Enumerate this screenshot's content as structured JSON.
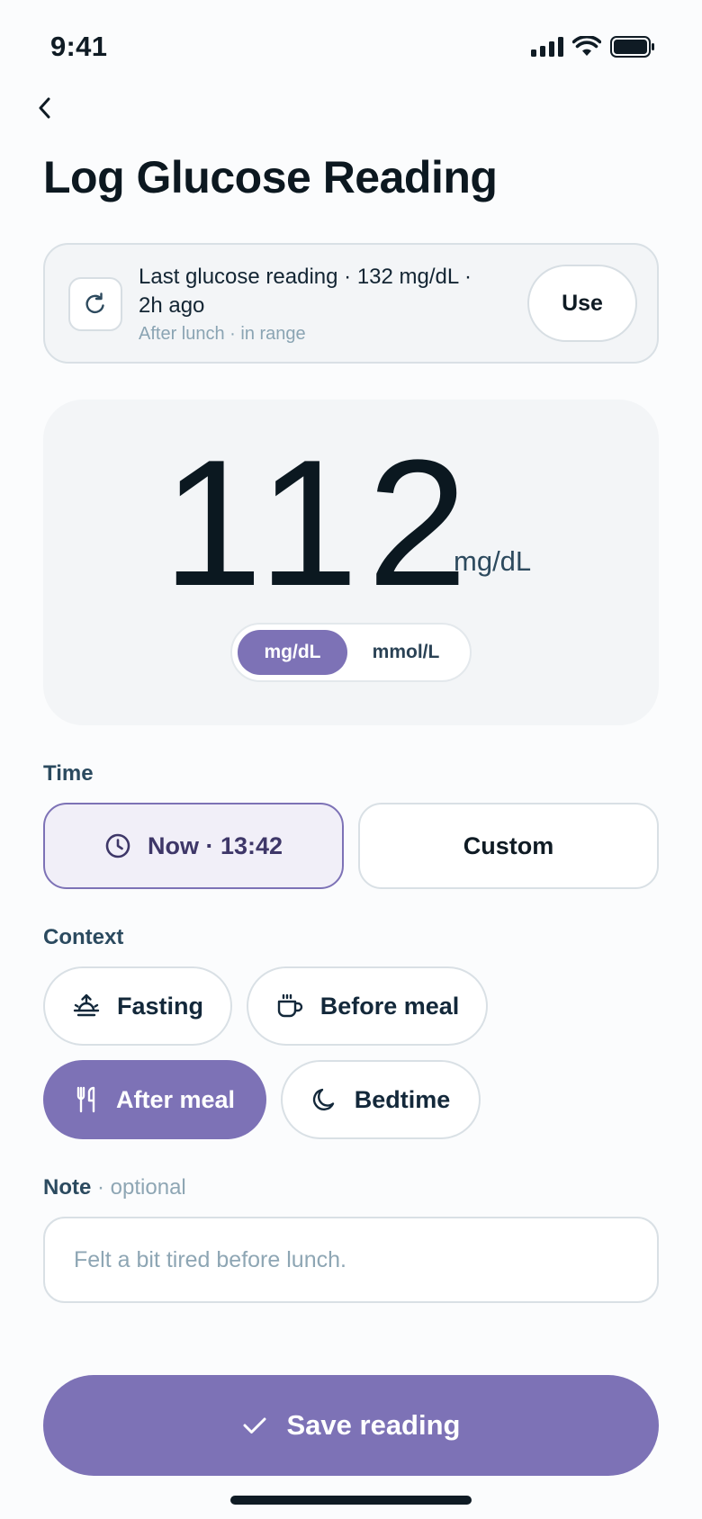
{
  "status_bar": {
    "time": "9:41"
  },
  "header": {
    "title": "Log Glucose Reading"
  },
  "last_reading": {
    "text": "Last glucose reading · 132 mg/dL · 2h ago",
    "subtext": "After lunch · in range",
    "use_label": "Use"
  },
  "reading": {
    "value": "112",
    "unit": "mg/dL",
    "unit_options": [
      "mg/dL",
      "mmol/L"
    ],
    "selected_unit": "mg/dL"
  },
  "time_section": {
    "label": "Time",
    "now_label": "Now · 13:42",
    "custom_label": "Custom",
    "selected": "now"
  },
  "context_section": {
    "label": "Context",
    "options": [
      {
        "label": "Fasting",
        "icon": "sunrise-icon"
      },
      {
        "label": "Before meal",
        "icon": "coffee-cup-icon"
      },
      {
        "label": "After meal",
        "icon": "utensils-icon"
      },
      {
        "label": "Bedtime",
        "icon": "moon-icon"
      }
    ],
    "selected": "After meal"
  },
  "note_section": {
    "label": "Note",
    "optional": "· optional",
    "value": "",
    "placeholder": "Felt a bit tired before lunch."
  },
  "save": {
    "label": "Save reading"
  },
  "colors": {
    "accent": "#7d72b6",
    "accent_tint": "#f1eff8",
    "card_bg": "#f3f5f7",
    "border": "#d9e0e5",
    "text_primary": "#0f1b24",
    "text_muted": "#8aa4b3"
  }
}
